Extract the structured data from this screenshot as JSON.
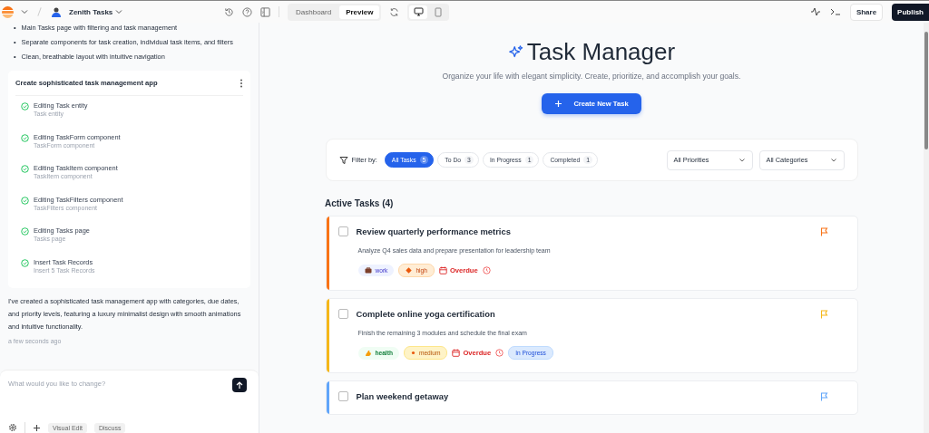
{
  "topbar": {
    "project": "Zenith Tasks",
    "view_tabs": [
      {
        "label": "Dashboard",
        "selected": false
      },
      {
        "label": "Preview",
        "selected": true
      }
    ],
    "devices": [
      {
        "kind": "desktop",
        "selected": true
      },
      {
        "kind": "mobile",
        "selected": false
      }
    ],
    "share": "Share",
    "publish": "Publish"
  },
  "chat": {
    "bullets": [
      {
        "marker": "•",
        "text": "Main Tasks page with filtering and task management"
      },
      {
        "marker": "•",
        "text": "Separate components for task creation, individual task items, and filters"
      },
      {
        "marker": "•",
        "text": "Clean, breathable layout with intuitive navigation"
      }
    ],
    "plan": {
      "title": "Create sophisticated task management app",
      "steps": [
        {
          "title": "Editing Task entity",
          "subtitle": "Task entity",
          "done": true
        },
        {
          "title": "Editing TaskForm component",
          "subtitle": "TaskForm component",
          "done": true
        },
        {
          "title": "Editing TaskItem component",
          "subtitle": "TaskItem component",
          "done": true
        },
        {
          "title": "Editing TaskFilters component",
          "subtitle": "TaskFilters component",
          "done": true
        },
        {
          "title": "Editing Tasks page",
          "subtitle": "Tasks page",
          "done": true
        },
        {
          "title": "Insert Task Records",
          "subtitle": "Insert 5 Task Records",
          "done": true
        }
      ]
    },
    "message": "I've created a sophisticated task management app with categories, due dates, and priority levels, featuring a luxury minimalist design with smooth animations and intuitive functionality.",
    "time": "a few seconds ago",
    "input": {
      "placeholder": "What would you like to change?"
    },
    "tools": [
      "Visual Edit",
      "Discuss"
    ]
  },
  "preview": {
    "title": "Task Manager",
    "subtitle": "Organize your life with elegant simplicity. Create, prioritize, and accomplish your goals.",
    "create_button": "Create New Task",
    "filter_label": "Filter by:",
    "filters": [
      {
        "label": "All Tasks",
        "count": "5",
        "selected": true
      },
      {
        "label": "To Do",
        "count": "3",
        "selected": false
      },
      {
        "label": "In Progress",
        "count": "1",
        "selected": false
      },
      {
        "label": "Completed",
        "count": "1",
        "selected": false
      }
    ],
    "dropdowns": [
      "All Priorities",
      "All Categories"
    ],
    "section_title": "Active Tasks (4)",
    "tasks": [
      {
        "title": "Review quarterly performance metrics",
        "description": "Analyze Q4 sales data and prepare presentation for leadership team",
        "color": "#f97316",
        "checked": false,
        "category": {
          "label": "work",
          "kind": "briefcase"
        },
        "priority": {
          "label": "high",
          "kind": "high"
        },
        "due": "Overdue"
      },
      {
        "title": "Complete online yoga certification",
        "description": "Finish the remaining 3 modules and schedule the final exam",
        "color": "#f5b719",
        "checked": false,
        "category": {
          "label": "health",
          "kind": "arm"
        },
        "priority": {
          "label": "medium",
          "kind": "medium"
        },
        "due": "Overdue",
        "status": "In Progress"
      },
      {
        "title": "Plan weekend getaway",
        "color": "#60a5fa",
        "checked": false
      }
    ]
  }
}
